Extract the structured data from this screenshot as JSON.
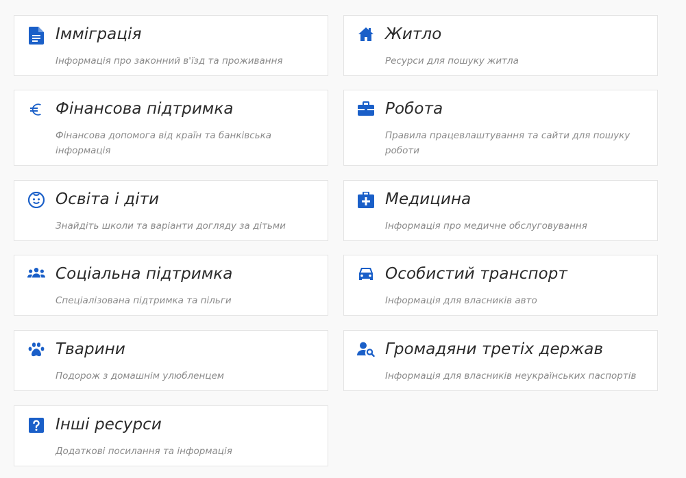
{
  "accent_color": "#1a5fc8",
  "cards": [
    {
      "icon": "document-icon",
      "title": "Імміграція",
      "description": "Інформація про законний в'їзд та проживання"
    },
    {
      "icon": "home-icon",
      "title": "Житло",
      "description": "Ресурси для пошуку житла"
    },
    {
      "icon": "euro-icon",
      "title": "Фінансова підтримка",
      "description": "Фінансова допомога від країн та банківська інформація"
    },
    {
      "icon": "briefcase-icon",
      "title": "Робота",
      "description": "Правила працевлаштування та сайти для пошуку роботи"
    },
    {
      "icon": "baby-face-icon",
      "title": "Освіта і діти",
      "description": "Знайдіть школи та варіанти догляду за дітьми"
    },
    {
      "icon": "medical-kit-icon",
      "title": "Медицина",
      "description": "Інформація про медичне обслуговування"
    },
    {
      "icon": "group-icon",
      "title": "Соціальна підтримка",
      "description": "Спеціалізована підтримка та пільги"
    },
    {
      "icon": "car-icon",
      "title": "Особистий транспорт",
      "description": "Інформація для власників авто"
    },
    {
      "icon": "paw-icon",
      "title": "Тварини",
      "description": "Подорож з домашнім улюбленцем"
    },
    {
      "icon": "person-search-icon",
      "title": "Громадяни третіх держав",
      "description": "Інформація для власників неукраїнських паспортів"
    },
    {
      "icon": "question-icon",
      "title": "Інші ресурси",
      "description": "Додаткові посилання та інформація"
    }
  ]
}
